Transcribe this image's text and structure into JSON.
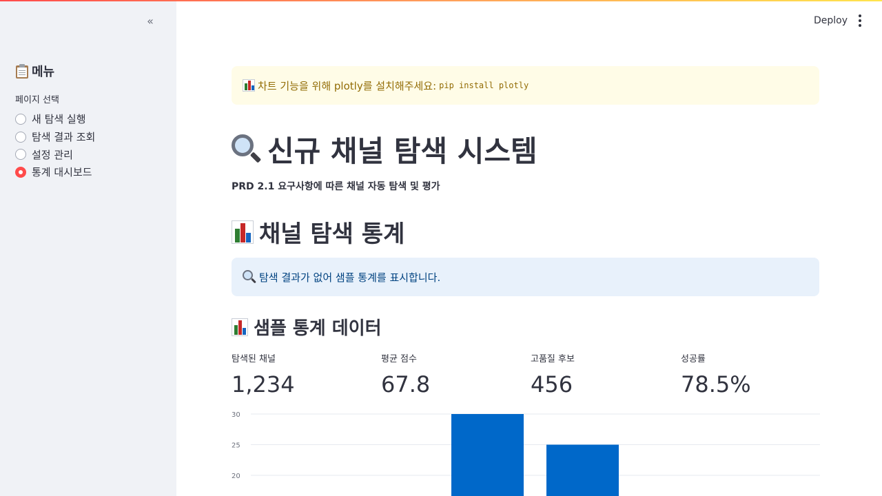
{
  "sidebar": {
    "collapse_glyph": "«",
    "title": "메뉴",
    "radio_label": "페이지 선택",
    "options": [
      {
        "label": "새 탐색 실행",
        "selected": false
      },
      {
        "label": "탐색 결과 조회",
        "selected": false
      },
      {
        "label": "설정 관리",
        "selected": false
      },
      {
        "label": "통계 대시보드",
        "selected": true
      }
    ]
  },
  "header": {
    "deploy_label": "Deploy"
  },
  "warning": {
    "text": "차트 기능을 위해 plotly를 설치해주세요:",
    "code": "pip install plotly",
    "icon": "bar-chart-emoji"
  },
  "page": {
    "title": "신규 채널 탐색 시스템",
    "subtitle": "PRD 2.1 요구사항에 따른 채널 자동 탐색 및 평가",
    "section_title": "채널 탐색 통계",
    "info_text": "탐색 결과가 없어 샘플 통계를 표시합니다.",
    "sample_title": "샘플 통계 데이터"
  },
  "metrics": [
    {
      "label": "탐색된 채널",
      "value": "1,234"
    },
    {
      "label": "평균 점수",
      "value": "67.8"
    },
    {
      "label": "고품질 후보",
      "value": "456"
    },
    {
      "label": "성공률",
      "value": "78.5%"
    }
  ],
  "colors": {
    "accent": "#ff4b4b",
    "bar": "#0068c9",
    "warning_bg": "#fffce7",
    "info_bg": "#e8f1fb"
  },
  "chart_data": {
    "type": "bar",
    "y_ticks": [
      "30",
      "25",
      "20"
    ],
    "ylim_visible": [
      19,
      30.5
    ],
    "values": [
      30,
      25
    ],
    "grid": true
  }
}
